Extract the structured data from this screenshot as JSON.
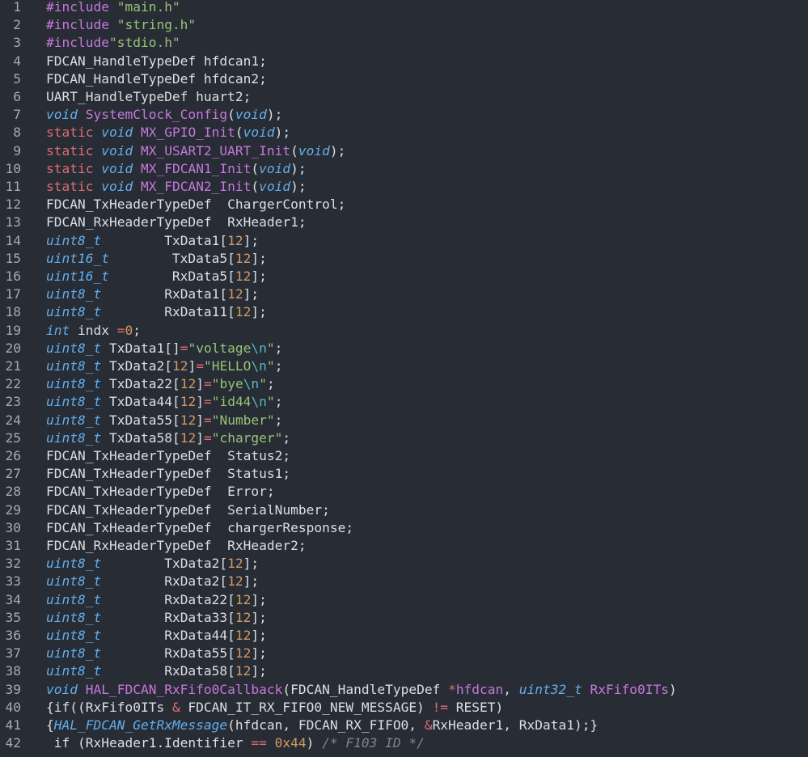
{
  "editor": {
    "lines": [
      {
        "n": "1",
        "t": [
          {
            "c": "pp",
            "v": "#include "
          },
          {
            "c": "str",
            "v": "\"main.h\""
          }
        ]
      },
      {
        "n": "2",
        "t": [
          {
            "c": "pp",
            "v": "#include "
          },
          {
            "c": "str",
            "v": "\"string.h\""
          }
        ]
      },
      {
        "n": "3",
        "t": [
          {
            "c": "pp",
            "v": "#include"
          },
          {
            "c": "str",
            "v": "\"stdio.h\""
          }
        ]
      },
      {
        "n": "4",
        "t": [
          {
            "c": "",
            "v": "FDCAN_HandleTypeDef hfdcan1;"
          }
        ]
      },
      {
        "n": "5",
        "t": [
          {
            "c": "",
            "v": "FDCAN_HandleTypeDef hfdcan2;"
          }
        ]
      },
      {
        "n": "6",
        "t": [
          {
            "c": "",
            "v": "UART_HandleTypeDef huart2;"
          }
        ]
      },
      {
        "n": "7",
        "t": [
          {
            "c": "type",
            "v": "void"
          },
          {
            "c": "",
            "v": " "
          },
          {
            "c": "fn",
            "v": "SystemClock_Config"
          },
          {
            "c": "",
            "v": "("
          },
          {
            "c": "type",
            "v": "void"
          },
          {
            "c": "",
            "v": ");"
          }
        ]
      },
      {
        "n": "8",
        "t": [
          {
            "c": "kw",
            "v": "static"
          },
          {
            "c": "",
            "v": " "
          },
          {
            "c": "type",
            "v": "void"
          },
          {
            "c": "",
            "v": " "
          },
          {
            "c": "fn",
            "v": "MX_GPIO_Init"
          },
          {
            "c": "",
            "v": "("
          },
          {
            "c": "type",
            "v": "void"
          },
          {
            "c": "",
            "v": ");"
          }
        ]
      },
      {
        "n": "9",
        "t": [
          {
            "c": "kw",
            "v": "static"
          },
          {
            "c": "",
            "v": " "
          },
          {
            "c": "type",
            "v": "void"
          },
          {
            "c": "",
            "v": " "
          },
          {
            "c": "fn",
            "v": "MX_USART2_UART_Init"
          },
          {
            "c": "",
            "v": "("
          },
          {
            "c": "type",
            "v": "void"
          },
          {
            "c": "",
            "v": ");"
          }
        ]
      },
      {
        "n": "10",
        "t": [
          {
            "c": "kw",
            "v": "static"
          },
          {
            "c": "",
            "v": " "
          },
          {
            "c": "type",
            "v": "void"
          },
          {
            "c": "",
            "v": " "
          },
          {
            "c": "fn",
            "v": "MX_FDCAN1_Init"
          },
          {
            "c": "",
            "v": "("
          },
          {
            "c": "type",
            "v": "void"
          },
          {
            "c": "",
            "v": ");"
          }
        ]
      },
      {
        "n": "11",
        "t": [
          {
            "c": "kw",
            "v": "static"
          },
          {
            "c": "",
            "v": " "
          },
          {
            "c": "type",
            "v": "void"
          },
          {
            "c": "",
            "v": " "
          },
          {
            "c": "fn",
            "v": "MX_FDCAN2_Init"
          },
          {
            "c": "",
            "v": "("
          },
          {
            "c": "type",
            "v": "void"
          },
          {
            "c": "",
            "v": ");"
          }
        ]
      },
      {
        "n": "12",
        "t": [
          {
            "c": "",
            "v": "FDCAN_TxHeaderTypeDef  ChargerControl;"
          }
        ]
      },
      {
        "n": "13",
        "t": [
          {
            "c": "",
            "v": "FDCAN_RxHeaderTypeDef  RxHeader1;"
          }
        ]
      },
      {
        "n": "14",
        "t": [
          {
            "c": "type",
            "v": "uint8_t"
          },
          {
            "c": "",
            "v": "        TxData1["
          },
          {
            "c": "num",
            "v": "12"
          },
          {
            "c": "",
            "v": "];"
          }
        ]
      },
      {
        "n": "15",
        "t": [
          {
            "c": "type",
            "v": "uint16_t"
          },
          {
            "c": "",
            "v": "        TxData5["
          },
          {
            "c": "num",
            "v": "12"
          },
          {
            "c": "",
            "v": "];"
          }
        ]
      },
      {
        "n": "16",
        "t": [
          {
            "c": "type",
            "v": "uint16_t"
          },
          {
            "c": "",
            "v": "        RxData5["
          },
          {
            "c": "num",
            "v": "12"
          },
          {
            "c": "",
            "v": "];"
          }
        ]
      },
      {
        "n": "17",
        "t": [
          {
            "c": "type",
            "v": "uint8_t"
          },
          {
            "c": "",
            "v": "        RxData1["
          },
          {
            "c": "num",
            "v": "12"
          },
          {
            "c": "",
            "v": "];"
          }
        ]
      },
      {
        "n": "18",
        "t": [
          {
            "c": "type",
            "v": "uint8_t"
          },
          {
            "c": "",
            "v": "        RxData11["
          },
          {
            "c": "num",
            "v": "12"
          },
          {
            "c": "",
            "v": "];"
          }
        ]
      },
      {
        "n": "19",
        "t": [
          {
            "c": "type",
            "v": "int"
          },
          {
            "c": "",
            "v": " indx "
          },
          {
            "c": "op",
            "v": "="
          },
          {
            "c": "num",
            "v": "0"
          },
          {
            "c": "",
            "v": ";"
          }
        ]
      },
      {
        "n": "20",
        "t": [
          {
            "c": "type",
            "v": "uint8_t"
          },
          {
            "c": "",
            "v": " TxData1[]"
          },
          {
            "c": "op",
            "v": "="
          },
          {
            "c": "str",
            "v": "\"voltage"
          },
          {
            "c": "esc",
            "v": "\\n"
          },
          {
            "c": "str",
            "v": "\""
          },
          {
            "c": "",
            "v": ";"
          }
        ]
      },
      {
        "n": "21",
        "t": [
          {
            "c": "type",
            "v": "uint8_t"
          },
          {
            "c": "",
            "v": " TxData2["
          },
          {
            "c": "num",
            "v": "12"
          },
          {
            "c": "",
            "v": "]"
          },
          {
            "c": "op",
            "v": "="
          },
          {
            "c": "str",
            "v": "\"HELLO"
          },
          {
            "c": "esc",
            "v": "\\n"
          },
          {
            "c": "str",
            "v": "\""
          },
          {
            "c": "",
            "v": ";"
          }
        ]
      },
      {
        "n": "22",
        "t": [
          {
            "c": "type",
            "v": "uint8_t"
          },
          {
            "c": "",
            "v": " TxData22["
          },
          {
            "c": "num",
            "v": "12"
          },
          {
            "c": "",
            "v": "]"
          },
          {
            "c": "op",
            "v": "="
          },
          {
            "c": "str",
            "v": "\"bye"
          },
          {
            "c": "esc",
            "v": "\\n"
          },
          {
            "c": "str",
            "v": "\""
          },
          {
            "c": "",
            "v": ";"
          }
        ]
      },
      {
        "n": "23",
        "t": [
          {
            "c": "type",
            "v": "uint8_t"
          },
          {
            "c": "",
            "v": " TxData44["
          },
          {
            "c": "num",
            "v": "12"
          },
          {
            "c": "",
            "v": "]"
          },
          {
            "c": "op",
            "v": "="
          },
          {
            "c": "str",
            "v": "\"id44"
          },
          {
            "c": "esc",
            "v": "\\n"
          },
          {
            "c": "str",
            "v": "\""
          },
          {
            "c": "",
            "v": ";"
          }
        ]
      },
      {
        "n": "24",
        "t": [
          {
            "c": "type",
            "v": "uint8_t"
          },
          {
            "c": "",
            "v": " TxData55["
          },
          {
            "c": "num",
            "v": "12"
          },
          {
            "c": "",
            "v": "]"
          },
          {
            "c": "op",
            "v": "="
          },
          {
            "c": "str",
            "v": "\"Number\""
          },
          {
            "c": "",
            "v": ";"
          }
        ]
      },
      {
        "n": "25",
        "t": [
          {
            "c": "type",
            "v": "uint8_t"
          },
          {
            "c": "",
            "v": " TxData58["
          },
          {
            "c": "num",
            "v": "12"
          },
          {
            "c": "",
            "v": "]"
          },
          {
            "c": "op",
            "v": "="
          },
          {
            "c": "str",
            "v": "\"charger\""
          },
          {
            "c": "",
            "v": ";"
          }
        ]
      },
      {
        "n": "26",
        "t": [
          {
            "c": "",
            "v": "FDCAN_TxHeaderTypeDef  Status2;"
          }
        ]
      },
      {
        "n": "27",
        "t": [
          {
            "c": "",
            "v": "FDCAN_TxHeaderTypeDef  Status1;"
          }
        ]
      },
      {
        "n": "28",
        "t": [
          {
            "c": "",
            "v": "FDCAN_TxHeaderTypeDef  Error;"
          }
        ]
      },
      {
        "n": "29",
        "t": [
          {
            "c": "",
            "v": "FDCAN_TxHeaderTypeDef  SerialNumber;"
          }
        ]
      },
      {
        "n": "30",
        "t": [
          {
            "c": "",
            "v": "FDCAN_TxHeaderTypeDef  chargerResponse;"
          }
        ]
      },
      {
        "n": "31",
        "t": [
          {
            "c": "",
            "v": "FDCAN_RxHeaderTypeDef  RxHeader2;"
          }
        ]
      },
      {
        "n": "32",
        "t": [
          {
            "c": "type",
            "v": "uint8_t"
          },
          {
            "c": "",
            "v": "        TxData2["
          },
          {
            "c": "num",
            "v": "12"
          },
          {
            "c": "",
            "v": "];"
          }
        ]
      },
      {
        "n": "33",
        "t": [
          {
            "c": "type",
            "v": "uint8_t"
          },
          {
            "c": "",
            "v": "        RxData2["
          },
          {
            "c": "num",
            "v": "12"
          },
          {
            "c": "",
            "v": "];"
          }
        ]
      },
      {
        "n": "34",
        "t": [
          {
            "c": "type",
            "v": "uint8_t"
          },
          {
            "c": "",
            "v": "        RxData22["
          },
          {
            "c": "num",
            "v": "12"
          },
          {
            "c": "",
            "v": "];"
          }
        ]
      },
      {
        "n": "35",
        "t": [
          {
            "c": "type",
            "v": "uint8_t"
          },
          {
            "c": "",
            "v": "        RxData33["
          },
          {
            "c": "num",
            "v": "12"
          },
          {
            "c": "",
            "v": "];"
          }
        ]
      },
      {
        "n": "36",
        "t": [
          {
            "c": "type",
            "v": "uint8_t"
          },
          {
            "c": "",
            "v": "        RxData44["
          },
          {
            "c": "num",
            "v": "12"
          },
          {
            "c": "",
            "v": "];"
          }
        ]
      },
      {
        "n": "37",
        "t": [
          {
            "c": "type",
            "v": "uint8_t"
          },
          {
            "c": "",
            "v": "        RxData55["
          },
          {
            "c": "num",
            "v": "12"
          },
          {
            "c": "",
            "v": "];"
          }
        ]
      },
      {
        "n": "38",
        "t": [
          {
            "c": "type",
            "v": "uint8_t"
          },
          {
            "c": "",
            "v": "        RxData58["
          },
          {
            "c": "num",
            "v": "12"
          },
          {
            "c": "",
            "v": "];"
          }
        ]
      },
      {
        "n": "39",
        "t": [
          {
            "c": "type",
            "v": "void"
          },
          {
            "c": "",
            "v": " "
          },
          {
            "c": "fn",
            "v": "HAL_FDCAN_RxFifo0Callback"
          },
          {
            "c": "",
            "v": "(FDCAN_HandleTypeDef "
          },
          {
            "c": "op",
            "v": "*"
          },
          {
            "c": "fn",
            "v": "hfdcan"
          },
          {
            "c": "",
            "v": ", "
          },
          {
            "c": "type",
            "v": "uint32_t"
          },
          {
            "c": "",
            "v": " "
          },
          {
            "c": "fn",
            "v": "RxFifo0ITs"
          },
          {
            "c": "",
            "v": ")"
          }
        ]
      },
      {
        "n": "40",
        "t": [
          {
            "c": "",
            "v": "{if((RxFifo0ITs "
          },
          {
            "c": "op",
            "v": "&"
          },
          {
            "c": "",
            "v": " FDCAN_IT_RX_FIFO0_NEW_MESSAGE) "
          },
          {
            "c": "op",
            "v": "!="
          },
          {
            "c": "",
            "v": " RESET)"
          }
        ]
      },
      {
        "n": "41",
        "t": [
          {
            "c": "",
            "v": "{"
          },
          {
            "c": "type",
            "v": "HAL_FDCAN_GetRxMessage"
          },
          {
            "c": "",
            "v": "(hfdcan, FDCAN_RX_FIFO0, "
          },
          {
            "c": "op",
            "v": "&"
          },
          {
            "c": "",
            "v": "RxHeader1, RxData1);}"
          }
        ]
      },
      {
        "n": "42",
        "t": [
          {
            "c": "",
            "v": " if (RxHeader1.Identifier "
          },
          {
            "c": "op",
            "v": "=="
          },
          {
            "c": "",
            "v": " "
          },
          {
            "c": "num",
            "v": "0x44"
          },
          {
            "c": "",
            "v": ") "
          },
          {
            "c": "cm",
            "v": "/* F103 ID */"
          }
        ]
      }
    ]
  }
}
